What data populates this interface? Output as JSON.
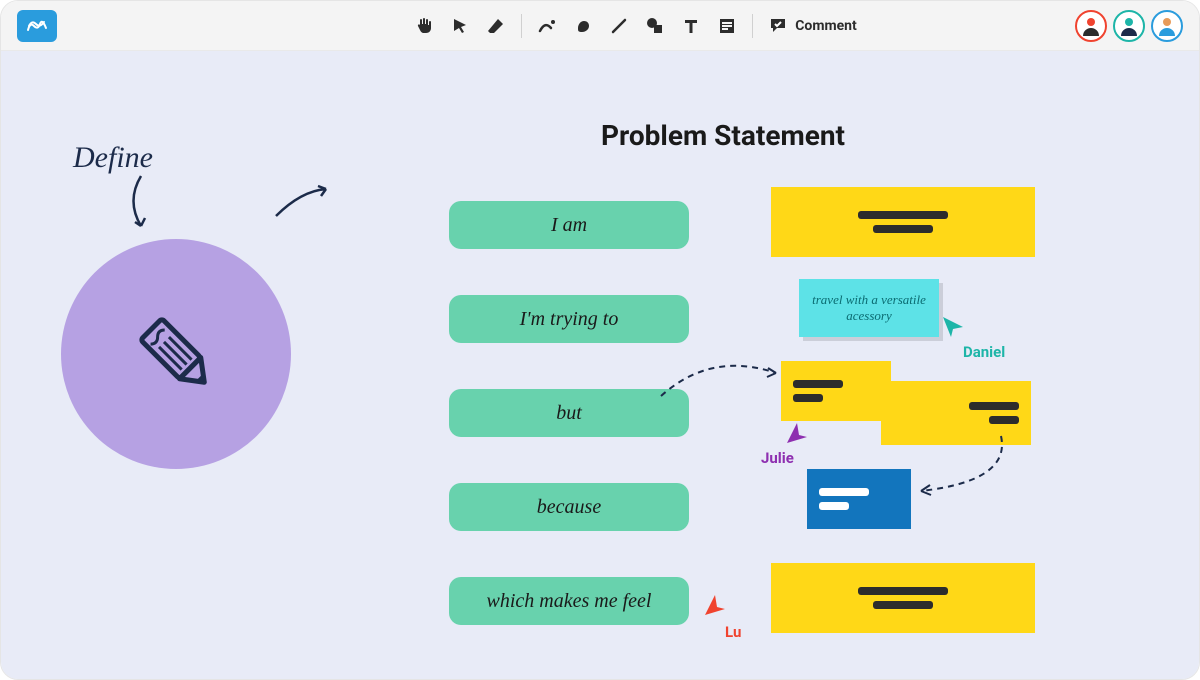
{
  "toolbar": {
    "comment_label": "Comment"
  },
  "canvas": {
    "title": "Problem Statement",
    "define_label": "Define",
    "prompts": [
      "I am",
      "I'm trying to",
      "but",
      "because",
      "which makes me feel"
    ],
    "cyan_note": "travel with a versatile acessory"
  },
  "cursors": {
    "daniel": "Daniel",
    "julie": "Julie",
    "lu": "Lu"
  }
}
